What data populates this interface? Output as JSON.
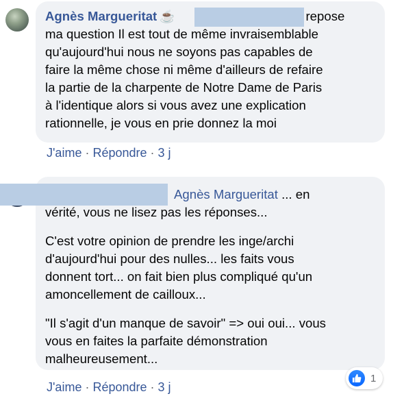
{
  "comment1": {
    "author": "Agnès Margueritat",
    "icon": "coffee-icon",
    "text_lines": [
      "Je repose",
      "ma question Il est tout de même invraisemblable",
      "qu'aujourd'hui nous ne soyons pas capables de",
      "faire la même chose ni même d'ailleurs de refaire",
      "la partie de la charpente de Notre Dame de Paris",
      "à l'identique alors si vous avez une explication",
      "rationnelle, je vous en prie donnez la moi"
    ],
    "actions": {
      "like": "J'aime",
      "reply": "Répondre",
      "sep": " · ",
      "time": "3 j"
    }
  },
  "comment2": {
    "mention": "Agnès Margueritat",
    "p1_line1": " ... en",
    "p1_line2": "vérité, vous ne lisez pas les réponses...",
    "p2_lines": [
      "C'est votre opinion de prendre les inge/archi",
      "d'aujourd'hui pour des nulles... les faits vous",
      "donnent tort... on fait bien plus compliqué qu'un",
      "amoncellement de cailloux..."
    ],
    "p3_lines": [
      "\"Il s'agit d'un manque de savoir\" => oui oui... vous",
      "vous en faites la parfaite démonstration",
      "malheureusement..."
    ],
    "actions": {
      "like": "J'aime",
      "reply": "Répondre",
      "sep": " · ",
      "time": "3 j"
    },
    "reactions": {
      "icon": "thumbs-up-icon",
      "count": "1",
      "color": "#1877f2"
    }
  },
  "colors": {
    "link": "#385898",
    "bubble": "#f0f2f5",
    "meta": "#65676b",
    "redaction": "#b9cde4"
  }
}
